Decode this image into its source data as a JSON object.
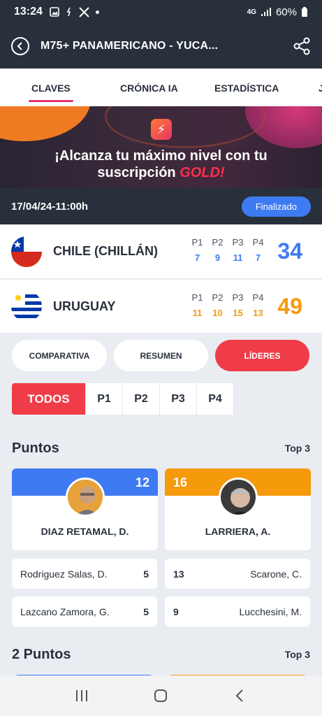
{
  "status_bar": {
    "time": "13:24",
    "icons": [
      "image-icon",
      "accessibility-icon",
      "x-logo-icon",
      "dot-icon"
    ],
    "network": "4G",
    "battery": "60%"
  },
  "app_bar": {
    "title": "M75+ PANAMERICANO - YUCA..."
  },
  "tabs": [
    {
      "label": "CLAVES",
      "active": true
    },
    {
      "label": "CRÓNICA IA",
      "active": false
    },
    {
      "label": "ESTADÍSTICA",
      "active": false
    }
  ],
  "banner": {
    "line1": "¡Alcanza tu máximo nivel con tu",
    "line2_prefix": "suscripción ",
    "line2_highlight": "GOLD!"
  },
  "game": {
    "datetime": "17/04/24-11:00h",
    "status": "Finalizado"
  },
  "teams": [
    {
      "name": "CHILE (CHILLÁN)",
      "period_labels": [
        "P1",
        "P2",
        "P3",
        "P4"
      ],
      "periods": [
        "7",
        "9",
        "11",
        "7"
      ],
      "total": "34",
      "color": "#3e7bf2"
    },
    {
      "name": "URUGUAY",
      "period_labels": [
        "P1",
        "P2",
        "P3",
        "P4"
      ],
      "periods": [
        "11",
        "10",
        "15",
        "13"
      ],
      "total": "49",
      "color": "#f59a0b"
    }
  ],
  "view_tabs": [
    {
      "label": "COMPARATIVA",
      "active": false
    },
    {
      "label": "RESUMEN",
      "active": false
    },
    {
      "label": "LÍDERES",
      "active": true
    }
  ],
  "period_filter": [
    {
      "label": "TODOS",
      "active": true
    },
    {
      "label": "P1",
      "active": false
    },
    {
      "label": "P2",
      "active": false
    },
    {
      "label": "P3",
      "active": false
    },
    {
      "label": "P4",
      "active": false
    }
  ],
  "sections": [
    {
      "title": "Puntos",
      "top_label": "Top 3",
      "leaders": [
        {
          "name": "DIAZ RETAMAL, D.",
          "value": "12",
          "color": "#3e7bf2"
        },
        {
          "name": "LARRIERA, A.",
          "value": "16",
          "color": "#f59a0b"
        }
      ],
      "others_left": [
        {
          "name": "Rodriguez Salas, D.",
          "value": "5"
        },
        {
          "name": "Lazcano Zamora, G.",
          "value": "5"
        }
      ],
      "others_right": [
        {
          "name": "Scarone, C.",
          "value": "13"
        },
        {
          "name": "Lucchesini, M.",
          "value": "9"
        }
      ]
    },
    {
      "title": "2 Puntos",
      "top_label": "Top 3"
    }
  ],
  "nav": [
    "recent-apps-icon",
    "home-icon",
    "back-icon"
  ]
}
